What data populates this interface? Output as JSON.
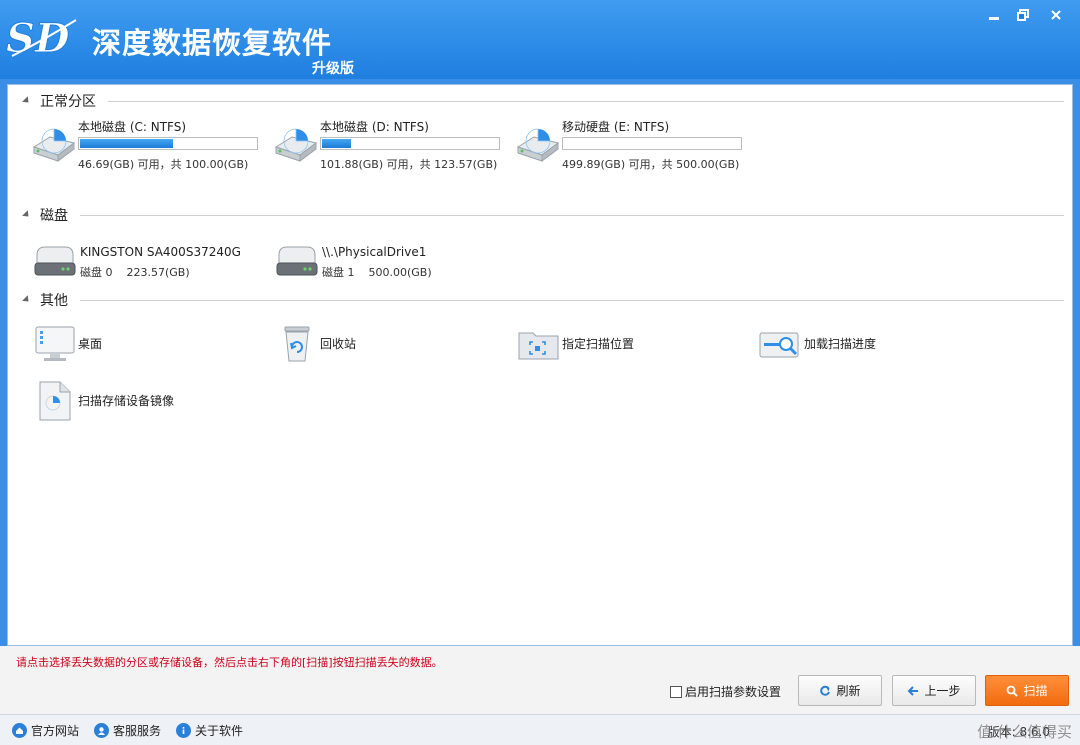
{
  "app": {
    "title": "深度数据恢复软件",
    "edition": "升级版",
    "logo_text": "SD"
  },
  "colors": {
    "titlebar": "#1f7fe0",
    "accent": "#1b7bd8",
    "scan_button": "#f26b0f",
    "hint_text": "#d0021b"
  },
  "sections": {
    "partitions": {
      "title": "正常分区",
      "items": [
        {
          "name": "本地磁盘 (C: NTFS)",
          "size": "46.69(GB) 可用，共 100.00(GB)",
          "used_fraction": 0.533,
          "icon": "partition-disk-icon"
        },
        {
          "name": "本地磁盘 (D: NTFS)",
          "size": "101.88(GB) 可用，共 123.57(GB)",
          "used_fraction": 0.176,
          "icon": "partition-disk-icon"
        },
        {
          "name": "移动硬盘 (E: NTFS)",
          "size": "499.89(GB) 可用，共 500.00(GB)",
          "used_fraction": 0.0,
          "icon": "partition-disk-icon"
        }
      ]
    },
    "disks": {
      "title": "磁盘",
      "items": [
        {
          "name": "KINGSTON SA400S37240G",
          "label": "磁盘 0",
          "size": "223.57(GB)",
          "icon": "hard-drive-icon"
        },
        {
          "name": "\\\\.\\PhysicalDrive1",
          "label": "磁盘 1",
          "size": "500.00(GB)",
          "icon": "hard-drive-icon"
        }
      ]
    },
    "others": {
      "title": "其他",
      "items": [
        {
          "label": "桌面",
          "icon": "desktop-icon"
        },
        {
          "label": "回收站",
          "icon": "recycle-bin-icon"
        },
        {
          "label": "指定扫描位置",
          "icon": "folder-scan-icon"
        },
        {
          "label": "加载扫描进度",
          "icon": "load-progress-icon"
        },
        {
          "label": "扫描存储设备镜像",
          "icon": "disk-image-icon"
        }
      ]
    }
  },
  "hint": "请点击选择丢失数据的分区或存储设备，然后点击右下角的[扫描]按钮扫描丢失的数据。",
  "footer": {
    "checkbox_label": "启用扫描参数设置",
    "refresh": "刷新",
    "back": "上一步",
    "scan": "扫描"
  },
  "status": {
    "links": [
      "官方网站",
      "客服服务",
      "关于软件"
    ],
    "version": "版本: 8.6.0",
    "watermark": "值 什么值得买"
  }
}
